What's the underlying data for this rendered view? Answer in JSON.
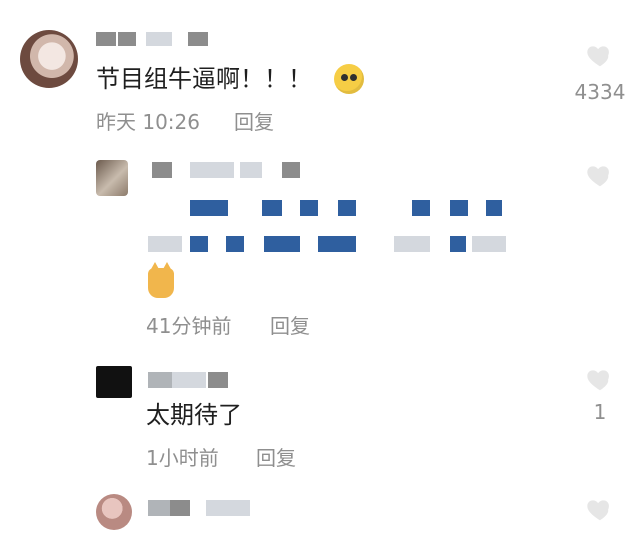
{
  "comments": [
    {
      "text": "节目组牛逼啊！！！",
      "time": "昨天 10:26",
      "reply_label": "回复",
      "likes": "4334"
    },
    {
      "time": "41分钟前",
      "reply_label": "回复"
    },
    {
      "text": "太期待了",
      "time": "1小时前",
      "reply_label": "回复",
      "likes": "1"
    }
  ]
}
